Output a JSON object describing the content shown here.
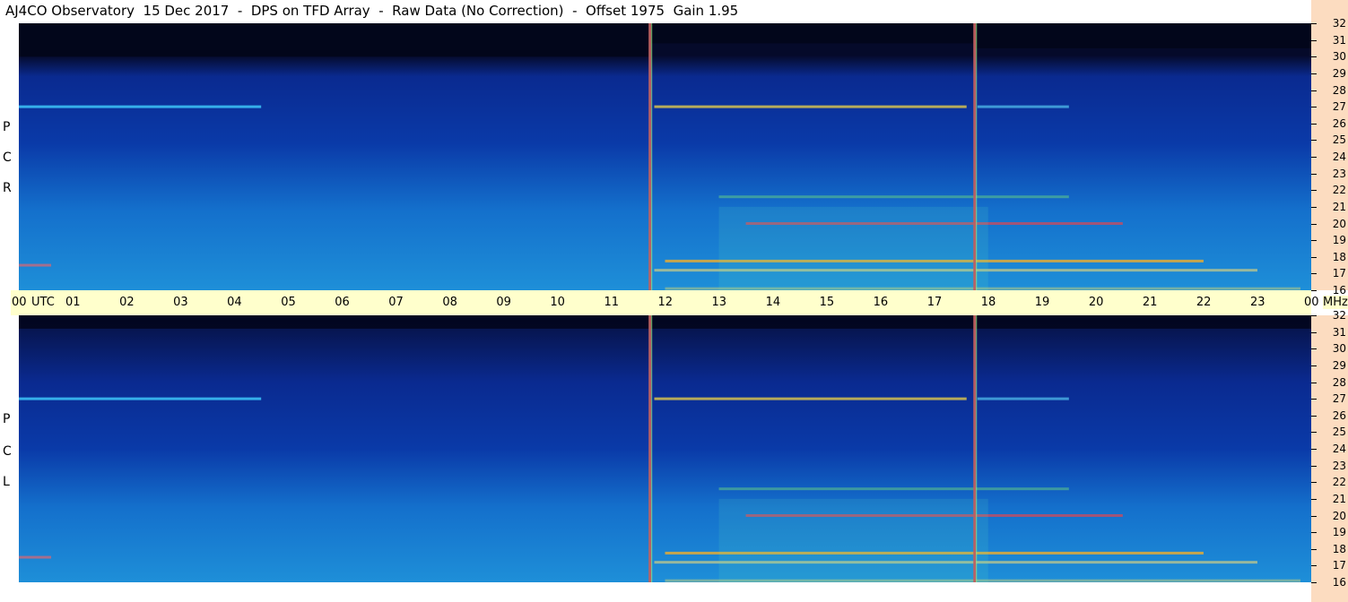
{
  "header": {
    "title": "AJ4CO Observatory  15 Dec 2017  -  DPS on TFD Array  -  Raw Data (No Correction)  -  Offset 1975  Gain 1.95"
  },
  "colors": {
    "panel_dark": "#050a2a",
    "panel_mid": "#0a3aa8",
    "panel_light": "#1e8fd8",
    "axis_bg_right": "#fcdcc0",
    "axis_bg_time": "#ffffcc",
    "marker_line": "#c06060"
  },
  "chart_data": {
    "type": "heatmap",
    "title": "AJ4CO Observatory  15 Dec 2017  -  DPS on TFD Array  -  Raw Data (No Correction)  -  Offset 1975  Gain 1.95",
    "x_axis": {
      "label": "UTC",
      "ticks": [
        "00",
        "01",
        "02",
        "03",
        "04",
        "05",
        "06",
        "07",
        "08",
        "09",
        "10",
        "11",
        "12",
        "13",
        "14",
        "15",
        "16",
        "17",
        "18",
        "19",
        "20",
        "21",
        "22",
        "23",
        "00"
      ],
      "range_hours": [
        0,
        24
      ]
    },
    "y_axis": {
      "unit": "MHz",
      "range": [
        16,
        32
      ],
      "ticks": [
        32,
        31,
        30,
        29,
        28,
        27,
        26,
        25,
        24,
        23,
        22,
        21,
        20,
        19,
        18,
        17,
        16
      ]
    },
    "panels": [
      {
        "name": "R C P",
        "letters": [
          "R",
          "C",
          "P"
        ]
      },
      {
        "name": "L C P",
        "letters": [
          "L",
          "C",
          "P"
        ]
      }
    ],
    "markers_utc_hours": [
      11.72,
      17.75
    ],
    "bright_bands_mhz": [
      27.0,
      17.75,
      20.0
    ],
    "grid": false
  }
}
